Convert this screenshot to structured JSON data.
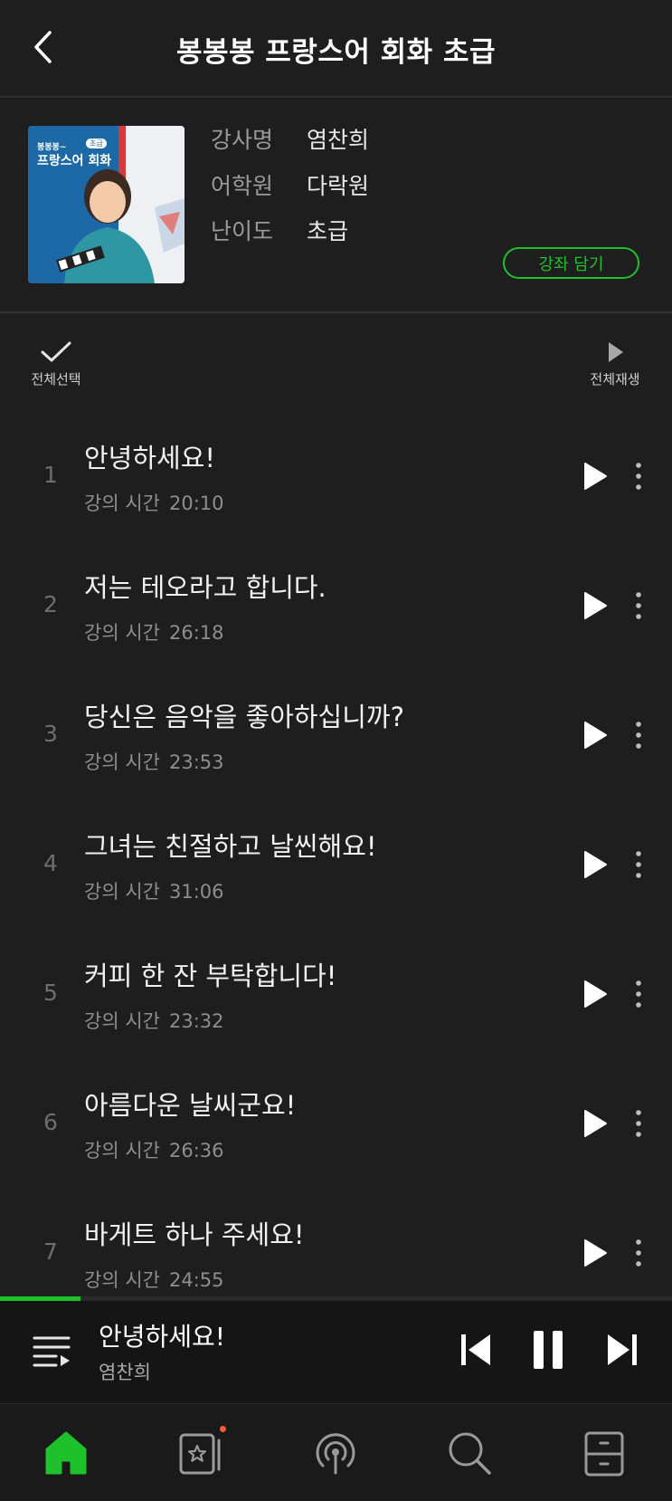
{
  "header": {
    "title": "봉봉봉 프랑스어 회화 초급"
  },
  "course": {
    "instructor_label": "강사명",
    "instructor": "염찬희",
    "academy_label": "어학원",
    "academy": "다락원",
    "level_label": "난이도",
    "level": "초급",
    "add_button": "강좌 담기",
    "cover": {
      "series": "봉봉봉~",
      "name": "프랑스어 회화",
      "badge": "초급"
    }
  },
  "toolbar": {
    "select_all": "전체선택",
    "play_all": "전체재생"
  },
  "lessons": [
    {
      "num": "1",
      "title": "안녕하세요!",
      "dur_label": "강의 시간",
      "duration": "20:10"
    },
    {
      "num": "2",
      "title": "저는 테오라고 합니다.",
      "dur_label": "강의 시간",
      "duration": "26:18"
    },
    {
      "num": "3",
      "title": "당신은 음악을 좋아하십니까?",
      "dur_label": "강의 시간",
      "duration": "23:53"
    },
    {
      "num": "4",
      "title": "그녀는 친절하고 날씬해요!",
      "dur_label": "강의 시간",
      "duration": "31:06"
    },
    {
      "num": "5",
      "title": "커피 한 잔 부탁합니다!",
      "dur_label": "강의 시간",
      "duration": "23:32"
    },
    {
      "num": "6",
      "title": "아름다운 날씨군요!",
      "dur_label": "강의 시간",
      "duration": "26:36"
    },
    {
      "num": "7",
      "title": "바게트 하나 주세요!",
      "dur_label": "강의 시간",
      "duration": "24:55"
    }
  ],
  "player": {
    "title": "안녕하세요!",
    "artist": "염찬희",
    "progress": 0.12
  },
  "nav": {
    "items": [
      "home-icon",
      "bookmark-star-icon",
      "podcast-icon",
      "search-icon",
      "library-icon"
    ],
    "active": "home-icon",
    "accent": "#1ec12b"
  }
}
